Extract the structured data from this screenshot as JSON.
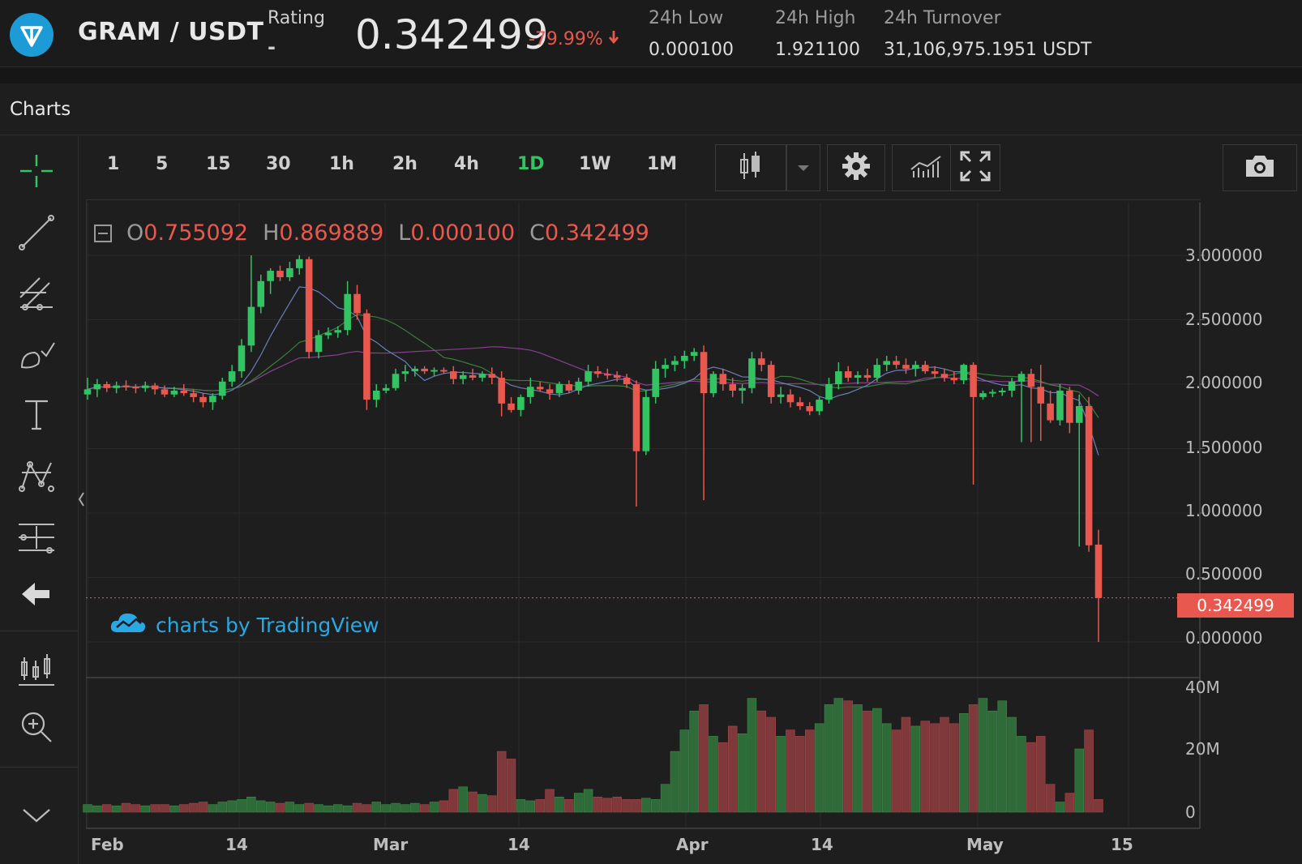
{
  "header": {
    "pair": "GRAM / USDT",
    "rating_label": "Rating",
    "rating_value": "-",
    "price": "0.342499",
    "change": "-79.99%",
    "low_label": "24h Low",
    "low_value": "0.000100",
    "high_label": "24h High",
    "high_value": "1.921100",
    "turnover_label": "24h Turnover",
    "turnover_value": "31,106,975.1951 USDT",
    "colors": {
      "up": "#33c363",
      "down": "#e8584f",
      "accent": "#1c9bd7"
    }
  },
  "panel": {
    "title": "Charts"
  },
  "toolbar": {
    "timeframes": [
      {
        "label": "1",
        "active": false
      },
      {
        "label": "5",
        "active": false
      },
      {
        "label": "15",
        "active": false
      },
      {
        "label": "30",
        "active": false
      },
      {
        "label": "1h",
        "active": false
      },
      {
        "label": "2h",
        "active": false
      },
      {
        "label": "4h",
        "active": false
      },
      {
        "label": "1D",
        "active": true
      },
      {
        "label": "1W",
        "active": false
      },
      {
        "label": "1M",
        "active": false
      }
    ],
    "icons": [
      "candles-icon",
      "dropdown-arrow-icon",
      "gear-icon",
      "indicators-icon",
      "fullscreen-icon",
      "camera-icon"
    ]
  },
  "left_tools": [
    "crosshair-icon",
    "trend-line-icon",
    "fib-tool-icon",
    "brush-icon",
    "text-icon",
    "pattern-icon",
    "measure-icon",
    "back-arrow-icon",
    "lock-candles-icon",
    "zoom-in-icon",
    "scroll-down-icon"
  ],
  "legend": {
    "o_label": "O",
    "o_value": "0.755092",
    "h_label": "H",
    "h_value": "0.869889",
    "l_label": "L",
    "l_value": "0.000100",
    "c_label": "C",
    "c_value": "0.342499"
  },
  "watermark": "charts by TradingView",
  "last_price_tag": "0.342499",
  "chart_data": {
    "type": "candlestick",
    "y_ticks": [
      "3.000000",
      "2.500000",
      "2.000000",
      "1.500000",
      "1.000000",
      "0.500000",
      "0.000000"
    ],
    "ylim": [
      0,
      3.2
    ],
    "volume_ticks": [
      "40M",
      "20M",
      "0"
    ],
    "x_ticks": [
      "Feb",
      "14",
      "Mar",
      "14",
      "Apr",
      "14",
      "May",
      "15"
    ],
    "candles": [
      {
        "o": 1.92,
        "h": 2.05,
        "l": 1.88,
        "c": 1.96,
        "v": 0.6
      },
      {
        "o": 1.96,
        "h": 2.04,
        "l": 1.9,
        "c": 2.0,
        "v": 0.5
      },
      {
        "o": 2.0,
        "h": 2.02,
        "l": 1.94,
        "c": 1.97,
        "v": 0.6
      },
      {
        "o": 1.97,
        "h": 2.02,
        "l": 1.93,
        "c": 1.99,
        "v": 0.5
      },
      {
        "o": 1.99,
        "h": 2.03,
        "l": 1.95,
        "c": 1.98,
        "v": 0.7
      },
      {
        "o": 1.98,
        "h": 2.0,
        "l": 1.93,
        "c": 1.97,
        "v": 0.6
      },
      {
        "o": 1.97,
        "h": 2.02,
        "l": 1.94,
        "c": 1.99,
        "v": 0.5
      },
      {
        "o": 1.99,
        "h": 2.01,
        "l": 1.92,
        "c": 1.96,
        "v": 0.6
      },
      {
        "o": 1.96,
        "h": 1.99,
        "l": 1.9,
        "c": 1.92,
        "v": 0.6
      },
      {
        "o": 1.92,
        "h": 1.98,
        "l": 1.9,
        "c": 1.95,
        "v": 0.5
      },
      {
        "o": 1.95,
        "h": 2.0,
        "l": 1.91,
        "c": 1.93,
        "v": 0.6
      },
      {
        "o": 1.93,
        "h": 1.96,
        "l": 1.86,
        "c": 1.9,
        "v": 0.7
      },
      {
        "o": 1.9,
        "h": 1.93,
        "l": 1.82,
        "c": 1.86,
        "v": 0.8
      },
      {
        "o": 1.86,
        "h": 1.93,
        "l": 1.8,
        "c": 1.91,
        "v": 0.6
      },
      {
        "o": 1.91,
        "h": 2.05,
        "l": 1.88,
        "c": 2.02,
        "v": 0.8
      },
      {
        "o": 2.02,
        "h": 2.15,
        "l": 1.98,
        "c": 2.1,
        "v": 0.9
      },
      {
        "o": 2.1,
        "h": 2.35,
        "l": 2.05,
        "c": 2.3,
        "v": 1.0
      },
      {
        "o": 2.3,
        "h": 3.0,
        "l": 2.25,
        "c": 2.6,
        "v": 1.2
      },
      {
        "o": 2.6,
        "h": 2.85,
        "l": 2.55,
        "c": 2.8,
        "v": 0.9
      },
      {
        "o": 2.8,
        "h": 2.9,
        "l": 2.7,
        "c": 2.88,
        "v": 0.8
      },
      {
        "o": 2.88,
        "h": 2.92,
        "l": 2.8,
        "c": 2.83,
        "v": 0.7
      },
      {
        "o": 2.83,
        "h": 2.95,
        "l": 2.8,
        "c": 2.9,
        "v": 0.8
      },
      {
        "o": 2.9,
        "h": 3.0,
        "l": 2.85,
        "c": 2.97,
        "v": 0.6
      },
      {
        "o": 2.97,
        "h": 2.99,
        "l": 2.2,
        "c": 2.25,
        "v": 0.7
      },
      {
        "o": 2.25,
        "h": 2.42,
        "l": 2.2,
        "c": 2.38,
        "v": 0.6
      },
      {
        "o": 2.38,
        "h": 2.44,
        "l": 2.35,
        "c": 2.4,
        "v": 0.5
      },
      {
        "o": 2.4,
        "h": 2.45,
        "l": 2.36,
        "c": 2.42,
        "v": 0.6
      },
      {
        "o": 2.42,
        "h": 2.8,
        "l": 2.38,
        "c": 2.7,
        "v": 0.5
      },
      {
        "o": 2.7,
        "h": 2.77,
        "l": 2.5,
        "c": 2.55,
        "v": 0.7
      },
      {
        "o": 2.55,
        "h": 2.58,
        "l": 1.8,
        "c": 1.88,
        "v": 0.6
      },
      {
        "o": 1.88,
        "h": 2.0,
        "l": 1.82,
        "c": 1.95,
        "v": 0.8
      },
      {
        "o": 1.95,
        "h": 2.0,
        "l": 1.93,
        "c": 1.97,
        "v": 0.6
      },
      {
        "o": 1.97,
        "h": 2.12,
        "l": 1.95,
        "c": 2.08,
        "v": 0.7
      },
      {
        "o": 2.08,
        "h": 2.15,
        "l": 2.02,
        "c": 2.1,
        "v": 0.6
      },
      {
        "o": 2.1,
        "h": 2.14,
        "l": 2.06,
        "c": 2.12,
        "v": 0.7
      },
      {
        "o": 2.12,
        "h": 2.14,
        "l": 2.08,
        "c": 2.1,
        "v": 0.6
      },
      {
        "o": 2.1,
        "h": 2.13,
        "l": 2.06,
        "c": 2.11,
        "v": 0.8
      },
      {
        "o": 2.11,
        "h": 2.13,
        "l": 2.08,
        "c": 2.1,
        "v": 0.9
      },
      {
        "o": 2.1,
        "h": 2.14,
        "l": 2.0,
        "c": 2.04,
        "v": 1.8
      },
      {
        "o": 2.04,
        "h": 2.1,
        "l": 2.0,
        "c": 2.07,
        "v": 2.0
      },
      {
        "o": 2.07,
        "h": 2.12,
        "l": 2.03,
        "c": 2.05,
        "v": 1.6
      },
      {
        "o": 2.05,
        "h": 2.1,
        "l": 2.02,
        "c": 2.08,
        "v": 1.4
      },
      {
        "o": 2.08,
        "h": 2.13,
        "l": 2.0,
        "c": 2.05,
        "v": 1.3
      },
      {
        "o": 2.05,
        "h": 2.1,
        "l": 1.75,
        "c": 1.85,
        "v": 4.8
      },
      {
        "o": 1.85,
        "h": 1.9,
        "l": 1.78,
        "c": 1.8,
        "v": 4.2
      },
      {
        "o": 1.8,
        "h": 1.92,
        "l": 1.75,
        "c": 1.9,
        "v": 1.0
      },
      {
        "o": 1.9,
        "h": 2.05,
        "l": 1.85,
        "c": 1.98,
        "v": 0.9
      },
      {
        "o": 1.98,
        "h": 2.02,
        "l": 1.94,
        "c": 1.96,
        "v": 1.0
      },
      {
        "o": 1.96,
        "h": 2.0,
        "l": 1.88,
        "c": 1.93,
        "v": 1.8
      },
      {
        "o": 1.93,
        "h": 2.02,
        "l": 1.9,
        "c": 2.0,
        "v": 1.2
      },
      {
        "o": 2.0,
        "h": 2.03,
        "l": 1.93,
        "c": 1.95,
        "v": 1.0
      },
      {
        "o": 1.95,
        "h": 2.05,
        "l": 1.92,
        "c": 2.02,
        "v": 1.5
      },
      {
        "o": 2.02,
        "h": 2.15,
        "l": 1.98,
        "c": 2.1,
        "v": 1.8
      },
      {
        "o": 2.1,
        "h": 2.14,
        "l": 2.05,
        "c": 2.08,
        "v": 1.2
      },
      {
        "o": 2.08,
        "h": 2.12,
        "l": 2.04,
        "c": 2.07,
        "v": 1.1
      },
      {
        "o": 2.07,
        "h": 2.1,
        "l": 2.02,
        "c": 2.05,
        "v": 1.2
      },
      {
        "o": 2.05,
        "h": 2.08,
        "l": 1.97,
        "c": 2.0,
        "v": 1.0
      },
      {
        "o": 2.0,
        "h": 2.03,
        "l": 1.05,
        "c": 1.48,
        "v": 1.0
      },
      {
        "o": 1.48,
        "h": 1.95,
        "l": 1.45,
        "c": 1.9,
        "v": 1.1
      },
      {
        "o": 1.9,
        "h": 2.18,
        "l": 1.85,
        "c": 2.12,
        "v": 1.0
      },
      {
        "o": 2.12,
        "h": 2.2,
        "l": 2.05,
        "c": 2.15,
        "v": 2.2
      },
      {
        "o": 2.15,
        "h": 2.22,
        "l": 2.1,
        "c": 2.18,
        "v": 4.8
      },
      {
        "o": 2.18,
        "h": 2.26,
        "l": 2.12,
        "c": 2.22,
        "v": 6.5
      },
      {
        "o": 2.22,
        "h": 2.28,
        "l": 2.18,
        "c": 2.25,
        "v": 8.0
      },
      {
        "o": 2.25,
        "h": 2.3,
        "l": 1.1,
        "c": 1.93,
        "v": 8.5
      },
      {
        "o": 1.93,
        "h": 2.1,
        "l": 1.9,
        "c": 2.08,
        "v": 6.0
      },
      {
        "o": 2.08,
        "h": 2.12,
        "l": 1.95,
        "c": 2.0,
        "v": 5.5
      },
      {
        "o": 2.0,
        "h": 2.05,
        "l": 1.9,
        "c": 1.95,
        "v": 6.8
      },
      {
        "o": 1.95,
        "h": 2.0,
        "l": 1.85,
        "c": 1.97,
        "v": 6.2
      },
      {
        "o": 1.97,
        "h": 2.25,
        "l": 1.93,
        "c": 2.2,
        "v": 9.0
      },
      {
        "o": 2.2,
        "h": 2.25,
        "l": 2.1,
        "c": 2.15,
        "v": 8.0
      },
      {
        "o": 2.15,
        "h": 2.18,
        "l": 1.85,
        "c": 1.9,
        "v": 7.5
      },
      {
        "o": 1.9,
        "h": 1.98,
        "l": 1.85,
        "c": 1.92,
        "v": 6.0
      },
      {
        "o": 1.92,
        "h": 1.96,
        "l": 1.82,
        "c": 1.86,
        "v": 6.5
      },
      {
        "o": 1.86,
        "h": 1.9,
        "l": 1.8,
        "c": 1.83,
        "v": 6.0
      },
      {
        "o": 1.83,
        "h": 1.86,
        "l": 1.76,
        "c": 1.79,
        "v": 6.5
      },
      {
        "o": 1.79,
        "h": 1.9,
        "l": 1.76,
        "c": 1.88,
        "v": 7.0
      },
      {
        "o": 1.88,
        "h": 2.05,
        "l": 1.85,
        "c": 2.0,
        "v": 8.5
      },
      {
        "o": 2.0,
        "h": 2.17,
        "l": 1.96,
        "c": 2.1,
        "v": 9.0
      },
      {
        "o": 2.1,
        "h": 2.14,
        "l": 2.02,
        "c": 2.05,
        "v": 8.8
      },
      {
        "o": 2.05,
        "h": 2.1,
        "l": 2.0,
        "c": 2.07,
        "v": 8.5
      },
      {
        "o": 2.07,
        "h": 2.12,
        "l": 2.02,
        "c": 2.05,
        "v": 8.0
      },
      {
        "o": 2.05,
        "h": 2.2,
        "l": 2.02,
        "c": 2.15,
        "v": 8.2
      },
      {
        "o": 2.15,
        "h": 2.22,
        "l": 2.1,
        "c": 2.18,
        "v": 7.0
      },
      {
        "o": 2.18,
        "h": 2.22,
        "l": 2.12,
        "c": 2.15,
        "v": 6.5
      },
      {
        "o": 2.15,
        "h": 2.2,
        "l": 2.08,
        "c": 2.12,
        "v": 7.5
      },
      {
        "o": 2.12,
        "h": 2.18,
        "l": 2.06,
        "c": 2.15,
        "v": 6.8
      },
      {
        "o": 2.15,
        "h": 2.18,
        "l": 2.08,
        "c": 2.1,
        "v": 7.2
      },
      {
        "o": 2.1,
        "h": 2.14,
        "l": 2.05,
        "c": 2.08,
        "v": 7.0
      },
      {
        "o": 2.08,
        "h": 2.12,
        "l": 2.02,
        "c": 2.05,
        "v": 7.5
      },
      {
        "o": 2.05,
        "h": 2.1,
        "l": 2.0,
        "c": 2.03,
        "v": 7.0
      },
      {
        "o": 2.03,
        "h": 2.16,
        "l": 2.0,
        "c": 2.15,
        "v": 7.8
      },
      {
        "o": 2.15,
        "h": 2.17,
        "l": 1.22,
        "c": 1.9,
        "v": 8.5
      },
      {
        "o": 1.9,
        "h": 1.95,
        "l": 1.88,
        "c": 1.93,
        "v": 9.0
      },
      {
        "o": 1.93,
        "h": 1.96,
        "l": 1.9,
        "c": 1.94,
        "v": 8.0
      },
      {
        "o": 1.94,
        "h": 1.97,
        "l": 1.91,
        "c": 1.95,
        "v": 8.8
      },
      {
        "o": 1.95,
        "h": 2.05,
        "l": 1.9,
        "c": 2.02,
        "v": 7.5
      },
      {
        "o": 2.02,
        "h": 2.1,
        "l": 1.55,
        "c": 2.08,
        "v": 6.0
      },
      {
        "o": 2.08,
        "h": 2.12,
        "l": 1.55,
        "c": 1.98,
        "v": 5.5
      },
      {
        "o": 1.98,
        "h": 2.15,
        "l": 1.56,
        "c": 1.85,
        "v": 6.0
      },
      {
        "o": 1.85,
        "h": 1.95,
        "l": 1.7,
        "c": 1.72,
        "v": 2.2
      },
      {
        "o": 1.72,
        "h": 2.0,
        "l": 1.68,
        "c": 1.95,
        "v": 0.8
      },
      {
        "o": 1.95,
        "h": 1.98,
        "l": 1.62,
        "c": 1.7,
        "v": 1.5
      },
      {
        "o": 1.7,
        "h": 1.92,
        "l": 0.74,
        "c": 1.83,
        "v": 5.0
      },
      {
        "o": 1.83,
        "h": 1.9,
        "l": 0.7,
        "c": 0.75,
        "v": 6.5
      },
      {
        "o": 0.755,
        "h": 0.87,
        "l": 0.0001,
        "c": 0.342,
        "v": 1.0
      }
    ]
  }
}
